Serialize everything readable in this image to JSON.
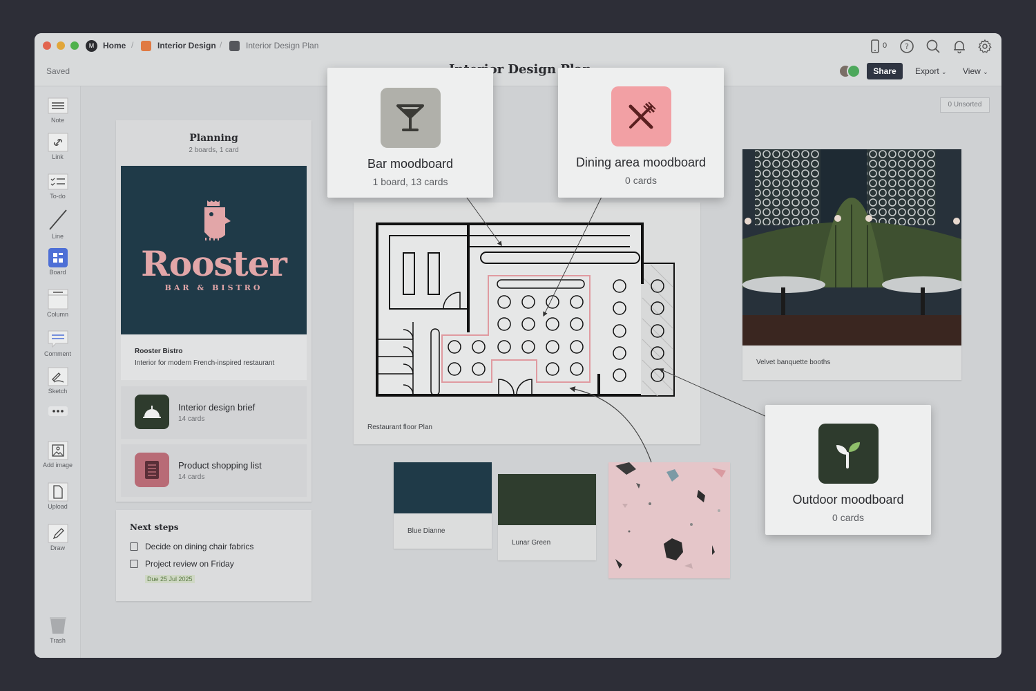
{
  "breadcrumb": {
    "home": "Home",
    "project": "Interior Design",
    "board": "Interior Design Plan"
  },
  "status": "Saved",
  "page_title": "Interior Design Plan",
  "topbar": {
    "device_count": "0",
    "share_label": "Share",
    "export_label": "Export",
    "view_label": "View"
  },
  "unsorted_badge": "0 Unsorted",
  "sidebar": {
    "tools": [
      "Note",
      "Link",
      "To-do",
      "Line",
      "Board",
      "Column",
      "Comment",
      "Sketch",
      "Add image",
      "Upload",
      "Draw"
    ],
    "trash": "Trash"
  },
  "planning": {
    "title": "Planning",
    "subtitle": "2 boards, 1 card",
    "logo_text": "Rooster",
    "logo_sub": "BAR & BISTRO",
    "logo_card_title": "Rooster Bistro",
    "logo_card_desc": "Interior for modern French-inspired restaurant",
    "boards": [
      {
        "title": "Interior design brief",
        "count": "14 cards"
      },
      {
        "title": "Product shopping list",
        "count": "14 cards"
      }
    ]
  },
  "next_steps": {
    "title": "Next steps",
    "items": [
      {
        "label": "Decide on dining chair fabrics"
      },
      {
        "label": "Project review on Friday",
        "due": "Due 25 Jul 2025"
      }
    ]
  },
  "popups": {
    "bar": {
      "title": "Bar moodboard",
      "sub": "1 board, 13 cards"
    },
    "dining": {
      "title": "Dining area moodboard",
      "sub": "0 cards"
    },
    "outdoor": {
      "title": "Outdoor moodboard",
      "sub": "0 cards"
    }
  },
  "floor_plan_caption": "Restaurant floor Plan",
  "photo_caption": "Velvet banquette booths",
  "swatches": [
    {
      "name": "Blue Dianne",
      "color": "#1f3a48"
    },
    {
      "name": "Lunar Green",
      "color": "#2f3d2e"
    }
  ],
  "colors": {
    "bar_icon_bg": "#b0b0aa",
    "dining_icon_bg": "#f2a0a4",
    "outdoor_icon_bg": "#2e3b2d",
    "brief_icon_bg": "#2e3b2d",
    "shopping_icon_bg": "#b86b76",
    "rooster_bg": "#1f3a48",
    "rooster_text": "#e2a6a8",
    "terrazzo_bg": "#e8c8cb"
  }
}
